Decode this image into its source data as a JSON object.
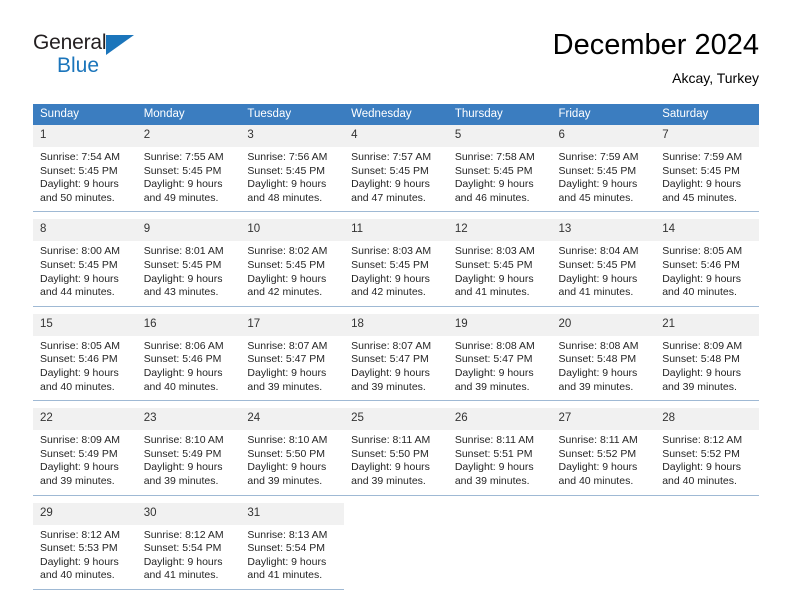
{
  "brand": {
    "name_part1": "General",
    "name_part2": "Blue",
    "triangle_color": "#1b75bb"
  },
  "header": {
    "title": "December 2024",
    "subtitle": "Akcay, Turkey"
  },
  "theme": {
    "header_row_bg": "#3b7dc0",
    "daynum_bg": "#f1f1f1",
    "cell_rule": "#9fb9d4",
    "text": "#252525"
  },
  "weekdays": [
    "Sunday",
    "Monday",
    "Tuesday",
    "Wednesday",
    "Thursday",
    "Friday",
    "Saturday"
  ],
  "weeks": [
    [
      {
        "day": "1",
        "sunrise": "Sunrise: 7:54 AM",
        "sunset": "Sunset: 5:45 PM",
        "daylight1": "Daylight: 9 hours",
        "daylight2": "and 50 minutes."
      },
      {
        "day": "2",
        "sunrise": "Sunrise: 7:55 AM",
        "sunset": "Sunset: 5:45 PM",
        "daylight1": "Daylight: 9 hours",
        "daylight2": "and 49 minutes."
      },
      {
        "day": "3",
        "sunrise": "Sunrise: 7:56 AM",
        "sunset": "Sunset: 5:45 PM",
        "daylight1": "Daylight: 9 hours",
        "daylight2": "and 48 minutes."
      },
      {
        "day": "4",
        "sunrise": "Sunrise: 7:57 AM",
        "sunset": "Sunset: 5:45 PM",
        "daylight1": "Daylight: 9 hours",
        "daylight2": "and 47 minutes."
      },
      {
        "day": "5",
        "sunrise": "Sunrise: 7:58 AM",
        "sunset": "Sunset: 5:45 PM",
        "daylight1": "Daylight: 9 hours",
        "daylight2": "and 46 minutes."
      },
      {
        "day": "6",
        "sunrise": "Sunrise: 7:59 AM",
        "sunset": "Sunset: 5:45 PM",
        "daylight1": "Daylight: 9 hours",
        "daylight2": "and 45 minutes."
      },
      {
        "day": "7",
        "sunrise": "Sunrise: 7:59 AM",
        "sunset": "Sunset: 5:45 PM",
        "daylight1": "Daylight: 9 hours",
        "daylight2": "and 45 minutes."
      }
    ],
    [
      {
        "day": "8",
        "sunrise": "Sunrise: 8:00 AM",
        "sunset": "Sunset: 5:45 PM",
        "daylight1": "Daylight: 9 hours",
        "daylight2": "and 44 minutes."
      },
      {
        "day": "9",
        "sunrise": "Sunrise: 8:01 AM",
        "sunset": "Sunset: 5:45 PM",
        "daylight1": "Daylight: 9 hours",
        "daylight2": "and 43 minutes."
      },
      {
        "day": "10",
        "sunrise": "Sunrise: 8:02 AM",
        "sunset": "Sunset: 5:45 PM",
        "daylight1": "Daylight: 9 hours",
        "daylight2": "and 42 minutes."
      },
      {
        "day": "11",
        "sunrise": "Sunrise: 8:03 AM",
        "sunset": "Sunset: 5:45 PM",
        "daylight1": "Daylight: 9 hours",
        "daylight2": "and 42 minutes."
      },
      {
        "day": "12",
        "sunrise": "Sunrise: 8:03 AM",
        "sunset": "Sunset: 5:45 PM",
        "daylight1": "Daylight: 9 hours",
        "daylight2": "and 41 minutes."
      },
      {
        "day": "13",
        "sunrise": "Sunrise: 8:04 AM",
        "sunset": "Sunset: 5:45 PM",
        "daylight1": "Daylight: 9 hours",
        "daylight2": "and 41 minutes."
      },
      {
        "day": "14",
        "sunrise": "Sunrise: 8:05 AM",
        "sunset": "Sunset: 5:46 PM",
        "daylight1": "Daylight: 9 hours",
        "daylight2": "and 40 minutes."
      }
    ],
    [
      {
        "day": "15",
        "sunrise": "Sunrise: 8:05 AM",
        "sunset": "Sunset: 5:46 PM",
        "daylight1": "Daylight: 9 hours",
        "daylight2": "and 40 minutes."
      },
      {
        "day": "16",
        "sunrise": "Sunrise: 8:06 AM",
        "sunset": "Sunset: 5:46 PM",
        "daylight1": "Daylight: 9 hours",
        "daylight2": "and 40 minutes."
      },
      {
        "day": "17",
        "sunrise": "Sunrise: 8:07 AM",
        "sunset": "Sunset: 5:47 PM",
        "daylight1": "Daylight: 9 hours",
        "daylight2": "and 39 minutes."
      },
      {
        "day": "18",
        "sunrise": "Sunrise: 8:07 AM",
        "sunset": "Sunset: 5:47 PM",
        "daylight1": "Daylight: 9 hours",
        "daylight2": "and 39 minutes."
      },
      {
        "day": "19",
        "sunrise": "Sunrise: 8:08 AM",
        "sunset": "Sunset: 5:47 PM",
        "daylight1": "Daylight: 9 hours",
        "daylight2": "and 39 minutes."
      },
      {
        "day": "20",
        "sunrise": "Sunrise: 8:08 AM",
        "sunset": "Sunset: 5:48 PM",
        "daylight1": "Daylight: 9 hours",
        "daylight2": "and 39 minutes."
      },
      {
        "day": "21",
        "sunrise": "Sunrise: 8:09 AM",
        "sunset": "Sunset: 5:48 PM",
        "daylight1": "Daylight: 9 hours",
        "daylight2": "and 39 minutes."
      }
    ],
    [
      {
        "day": "22",
        "sunrise": "Sunrise: 8:09 AM",
        "sunset": "Sunset: 5:49 PM",
        "daylight1": "Daylight: 9 hours",
        "daylight2": "and 39 minutes."
      },
      {
        "day": "23",
        "sunrise": "Sunrise: 8:10 AM",
        "sunset": "Sunset: 5:49 PM",
        "daylight1": "Daylight: 9 hours",
        "daylight2": "and 39 minutes."
      },
      {
        "day": "24",
        "sunrise": "Sunrise: 8:10 AM",
        "sunset": "Sunset: 5:50 PM",
        "daylight1": "Daylight: 9 hours",
        "daylight2": "and 39 minutes."
      },
      {
        "day": "25",
        "sunrise": "Sunrise: 8:11 AM",
        "sunset": "Sunset: 5:50 PM",
        "daylight1": "Daylight: 9 hours",
        "daylight2": "and 39 minutes."
      },
      {
        "day": "26",
        "sunrise": "Sunrise: 8:11 AM",
        "sunset": "Sunset: 5:51 PM",
        "daylight1": "Daylight: 9 hours",
        "daylight2": "and 39 minutes."
      },
      {
        "day": "27",
        "sunrise": "Sunrise: 8:11 AM",
        "sunset": "Sunset: 5:52 PM",
        "daylight1": "Daylight: 9 hours",
        "daylight2": "and 40 minutes."
      },
      {
        "day": "28",
        "sunrise": "Sunrise: 8:12 AM",
        "sunset": "Sunset: 5:52 PM",
        "daylight1": "Daylight: 9 hours",
        "daylight2": "and 40 minutes."
      }
    ],
    [
      {
        "day": "29",
        "sunrise": "Sunrise: 8:12 AM",
        "sunset": "Sunset: 5:53 PM",
        "daylight1": "Daylight: 9 hours",
        "daylight2": "and 40 minutes."
      },
      {
        "day": "30",
        "sunrise": "Sunrise: 8:12 AM",
        "sunset": "Sunset: 5:54 PM",
        "daylight1": "Daylight: 9 hours",
        "daylight2": "and 41 minutes."
      },
      {
        "day": "31",
        "sunrise": "Sunrise: 8:13 AM",
        "sunset": "Sunset: 5:54 PM",
        "daylight1": "Daylight: 9 hours",
        "daylight2": "and 41 minutes."
      },
      null,
      null,
      null,
      null
    ]
  ]
}
